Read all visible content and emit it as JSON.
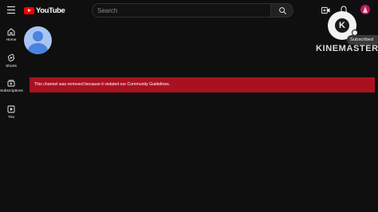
{
  "header": {
    "logo_text": "YouTube",
    "search_placeholder": "Search",
    "icons": [
      "menu-icon",
      "search-icon",
      "create-icon",
      "bell-icon"
    ],
    "brand_color": "#ff0000"
  },
  "sidebar": {
    "items": [
      {
        "label": "Home",
        "icon": "home-icon"
      },
      {
        "label": "Shorts",
        "icon": "shorts-icon"
      },
      {
        "label": "Subscriptions",
        "icon": "subscriptions-icon"
      },
      {
        "label": "You",
        "icon": "you-icon"
      }
    ]
  },
  "channel": {
    "removal_message": "This channel was removed because it violated our Community Guidelines.",
    "banner_color": "#aa1120"
  },
  "watermark": {
    "logo_letter": "K",
    "subscribed_label": "Subscribed",
    "name": "KINEMASTER"
  }
}
